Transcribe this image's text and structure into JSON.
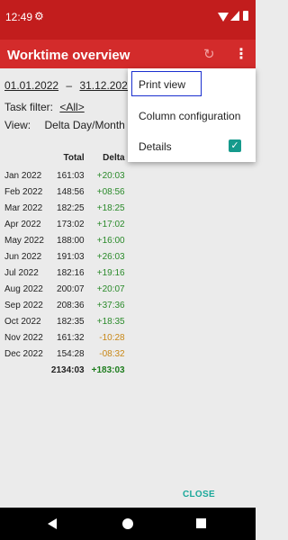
{
  "status_bar": {
    "time": "12:49"
  },
  "app_bar": {
    "title": "Worktime overview"
  },
  "filters": {
    "date_from": "01.01.2022",
    "date_sep": "–",
    "date_to": "31.12.2022",
    "task_filter_label": "Task filter:",
    "task_filter_value": "<All>",
    "view_label": "View:",
    "view_value": "Delta Day/Month"
  },
  "table": {
    "headers": {
      "month": "",
      "total": "Total",
      "delta": "Delta"
    },
    "rows": [
      {
        "month": "Jan 2022",
        "total": "161:03",
        "delta": "+20:03",
        "sign": "pos"
      },
      {
        "month": "Feb 2022",
        "total": "148:56",
        "delta": "+08:56",
        "sign": "pos"
      },
      {
        "month": "Mar 2022",
        "total": "182:25",
        "delta": "+18:25",
        "sign": "pos"
      },
      {
        "month": "Apr 2022",
        "total": "173:02",
        "delta": "+17:02",
        "sign": "pos"
      },
      {
        "month": "May 2022",
        "total": "188:00",
        "delta": "+16:00",
        "sign": "pos"
      },
      {
        "month": "Jun 2022",
        "total": "191:03",
        "delta": "+26:03",
        "sign": "pos"
      },
      {
        "month": "Jul 2022",
        "total": "182:16",
        "delta": "+19:16",
        "sign": "pos"
      },
      {
        "month": "Aug 2022",
        "total": "200:07",
        "delta": "+20:07",
        "sign": "pos"
      },
      {
        "month": "Sep 2022",
        "total": "208:36",
        "delta": "+37:36",
        "sign": "pos"
      },
      {
        "month": "Oct 2022",
        "total": "182:35",
        "delta": "+18:35",
        "sign": "pos"
      },
      {
        "month": "Nov 2022",
        "total": "161:32",
        "delta": "-10:28",
        "sign": "neg"
      },
      {
        "month": "Dec 2022",
        "total": "154:28",
        "delta": "-08:32",
        "sign": "neg"
      }
    ],
    "sum": {
      "total": "2134:03",
      "delta": "+183:03"
    }
  },
  "close_label": "CLOSE",
  "menu": {
    "items": [
      {
        "label": "Print view"
      },
      {
        "label": "Column configuration"
      },
      {
        "label": "Details",
        "checked": true
      }
    ]
  },
  "colors": {
    "primary": "#d32b2b",
    "status_bar": "#c21d1d",
    "accent": "#159a8c",
    "positive": "#2a8a2a",
    "negative": "#c88716"
  }
}
